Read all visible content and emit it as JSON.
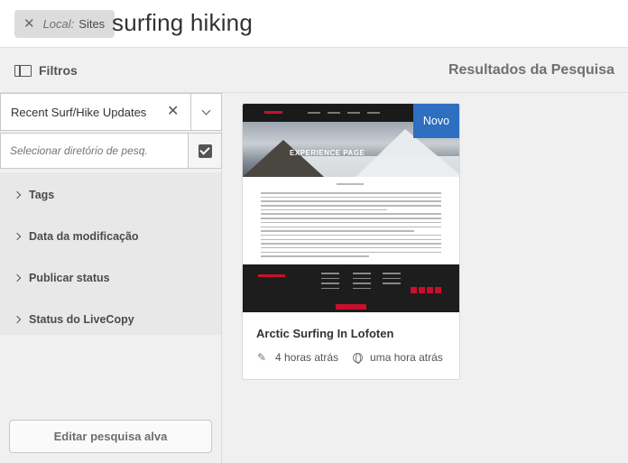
{
  "omnisearch": {
    "tag_scope": "Local:",
    "tag_value": "Sites",
    "query": "surfing hiking"
  },
  "header": {
    "rail_title": "Filtros",
    "results_title": "Resultados da Pesquisa"
  },
  "rail": {
    "saved_search": "Recent Surf/Hike Updates",
    "path_placeholder": "Selecionar diretório de pesq.",
    "facets": [
      "Tags",
      "Data da modificação",
      "Publicar status",
      "Status do LiveCopy"
    ],
    "edit_button": "Editar pesquisa alva"
  },
  "results": [
    {
      "badge": "Novo",
      "thumbnail_heading": "EXPERIENCE PAGE",
      "title": "Arctic Surfing In Lofoten",
      "modified": "4 horas atrás",
      "published": "uma hora atrás"
    }
  ],
  "colors": {
    "badge": "#2f6fc1",
    "brand_red": "#c8102e"
  }
}
